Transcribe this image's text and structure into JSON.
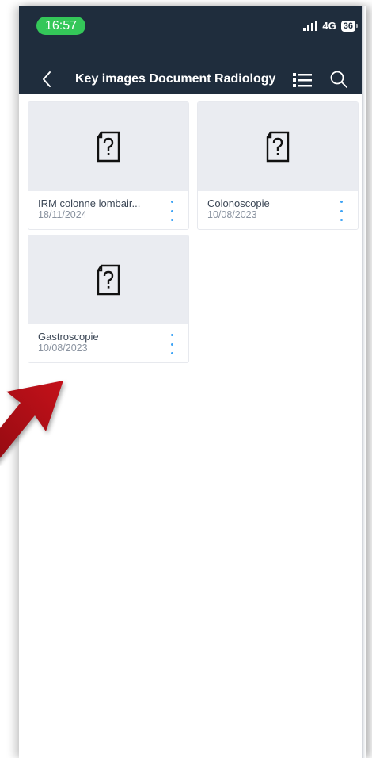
{
  "status_bar": {
    "time": "16:57",
    "network": "4G",
    "battery": "36",
    "time_pill_color": "#34c759"
  },
  "navbar": {
    "title": "Key images Document Radiology",
    "back_icon": "chevron-left-icon",
    "list_icon": "list-view-icon",
    "search_icon": "search-icon",
    "background_color": "#1f2d3d"
  },
  "documents": [
    {
      "title": "IRM colonne lombair...",
      "date": "18/11/2024",
      "icon": "unknown-document-icon"
    },
    {
      "title": "Colonoscopie",
      "date": "10/08/2023",
      "icon": "unknown-document-icon"
    },
    {
      "title": "Gastroscopie",
      "date": "10/08/2023",
      "icon": "unknown-document-icon"
    }
  ],
  "colors": {
    "menu_dots": "#3da3f5",
    "thumbnail_bg": "#eaecf1",
    "annotation_arrow": "#b00d14"
  }
}
